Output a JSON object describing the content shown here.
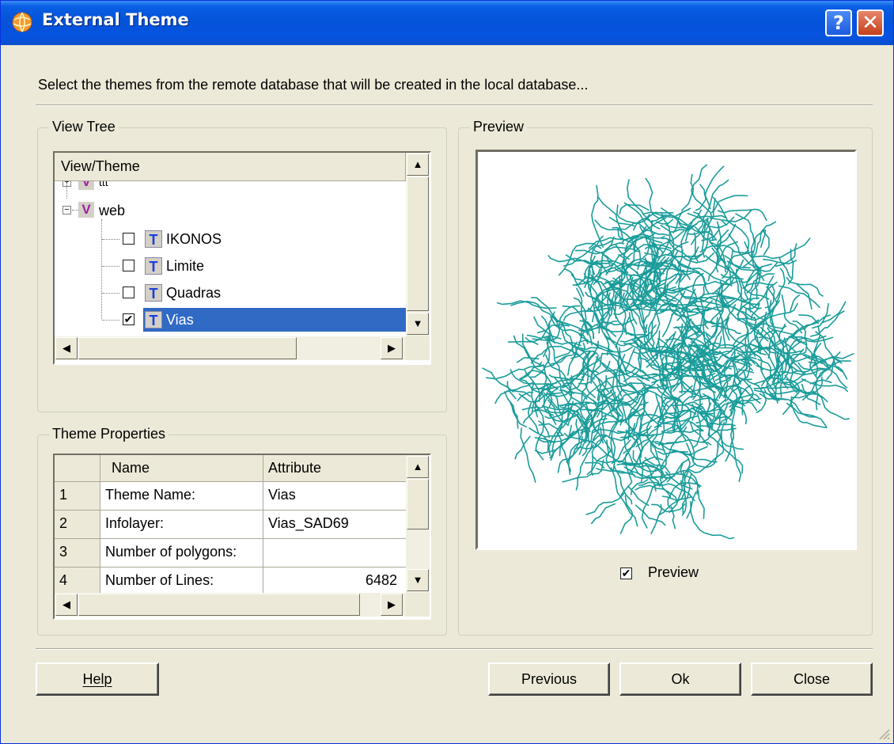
{
  "window": {
    "title": "External Theme",
    "help_glyph": "?",
    "close_glyph": "✕",
    "instruction": "Select the themes from the remote database that will be created in the local database..."
  },
  "view_tree": {
    "group_label": "View Tree",
    "column_header": "View/Theme",
    "partial_view_label": "ttt",
    "view": {
      "label": "web",
      "expanded": true
    },
    "themes": [
      {
        "label": "IKONOS",
        "checked": false,
        "selected": false
      },
      {
        "label": "Limite",
        "checked": false,
        "selected": false
      },
      {
        "label": "Quadras",
        "checked": false,
        "selected": false
      },
      {
        "label": "Vias",
        "checked": true,
        "selected": true
      }
    ],
    "view_icon": "V",
    "theme_icon": "T"
  },
  "theme_properties": {
    "group_label": "Theme Properties",
    "columns": [
      "",
      "Name",
      "Attribute"
    ],
    "rows": [
      {
        "n": "1",
        "name": "Theme Name:",
        "attribute": "Vias"
      },
      {
        "n": "2",
        "name": "Infolayer:",
        "attribute": "Vias_SAD69"
      },
      {
        "n": "3",
        "name": "Number of polygons:",
        "attribute": ""
      },
      {
        "n": "4",
        "name": "Number of Lines:",
        "attribute": "6482"
      }
    ]
  },
  "preview": {
    "group_label": "Preview",
    "checkbox_label": "Preview",
    "checked": true,
    "map_color": "#1a9c9a"
  },
  "buttons": {
    "help": "Help",
    "previous": "Previous",
    "ok": "Ok",
    "close": "Close"
  },
  "icons": {
    "scroll_up": "▲",
    "scroll_down": "▼",
    "scroll_left": "◀",
    "scroll_right": "▶",
    "check": "✔"
  }
}
